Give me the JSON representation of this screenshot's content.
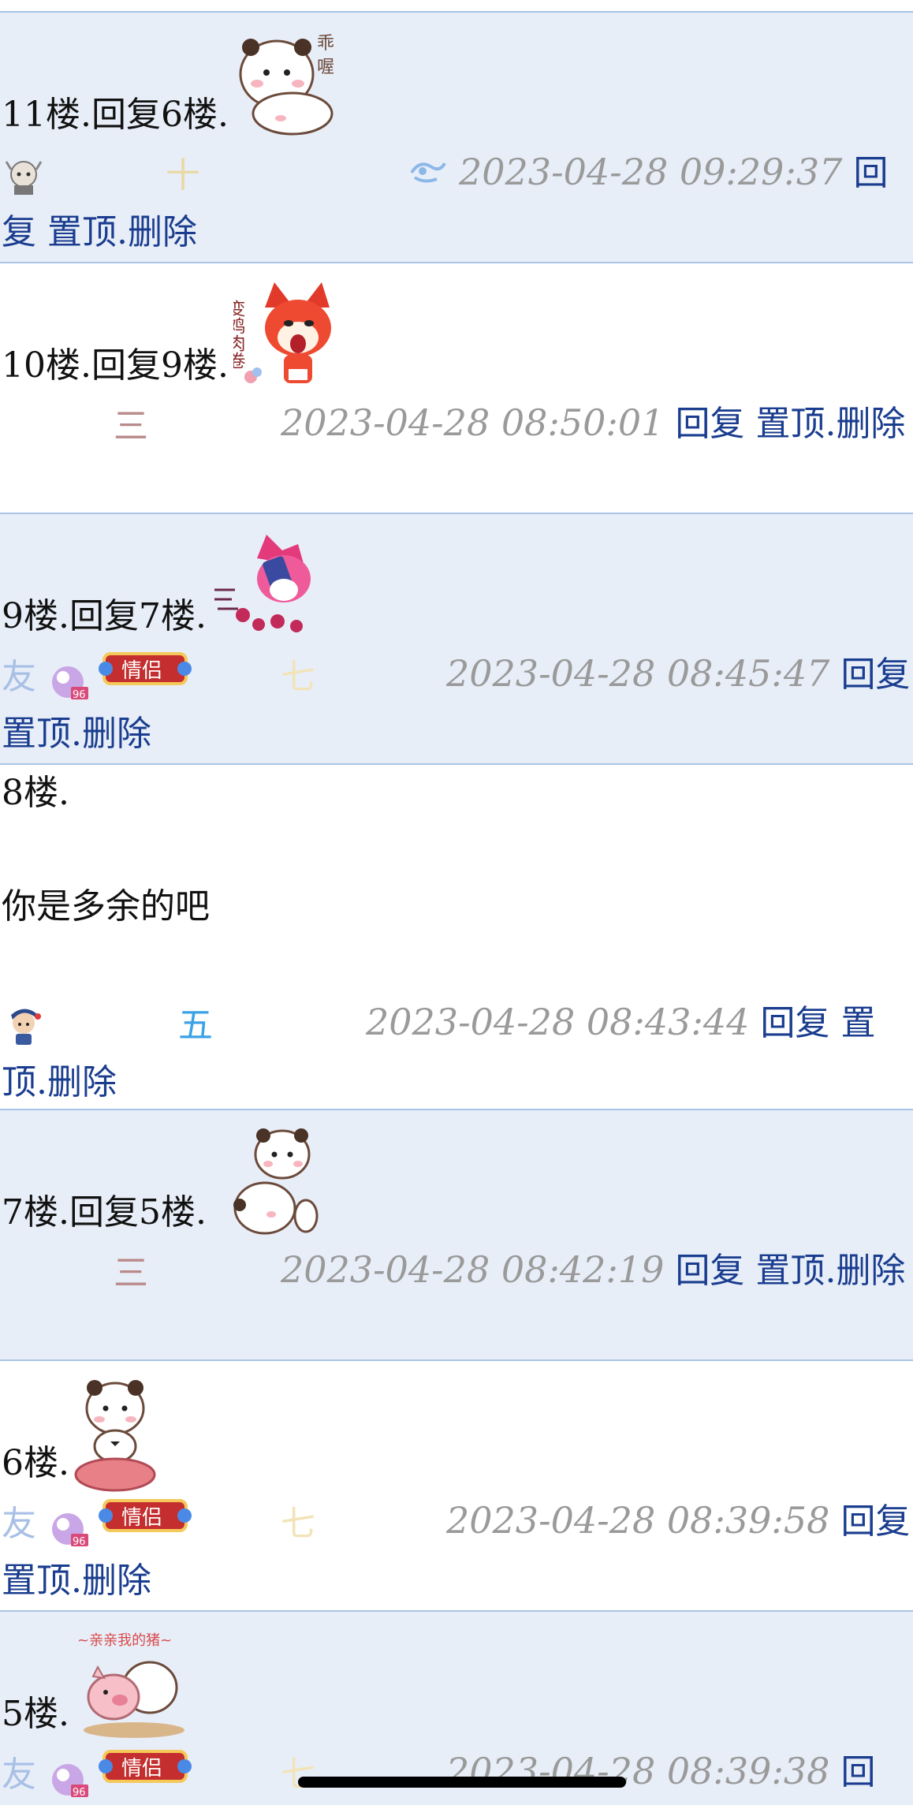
{
  "posts": [
    {
      "text": "11楼.回复6楼.",
      "rank": "十",
      "rank_color": "#e8d9a6",
      "timestamp": "2023-04-28 09:29:37",
      "reply": "回复",
      "pin": "置顶",
      "dot": ".",
      "delete": "删除",
      "sticker": "panda-hug-sticker",
      "sticker_text_1": "乖",
      "sticker_text_2": "喔"
    },
    {
      "text": "10楼.回复9楼.",
      "rank": "三",
      "rank_color": "#b98a8a",
      "timestamp": "2023-04-28 08:50:01",
      "reply": "回复",
      "pin": "置顶",
      "dot": ".",
      "delete": "删除",
      "sticker": "red-fox-sticker",
      "sticker_text": "变鸡肉卷"
    },
    {
      "text": "9楼.回复7楼.",
      "rank": "七",
      "rank_color": "#f2e3b8",
      "timestamp": "2023-04-28 08:45:47",
      "reply": "回复",
      "pin": "置顶",
      "dot": ".",
      "delete": "删除",
      "sticker": "pink-fox-sticker",
      "badge": "情侣",
      "badge_num": "96"
    },
    {
      "text": "8楼.",
      "body": "你是多余的吧",
      "rank": "五",
      "rank_color": "#3aa2e6",
      "timestamp": "2023-04-28 08:43:44",
      "reply": "回复",
      "pin": "置顶",
      "dot": ".",
      "delete": "删除"
    },
    {
      "text": "7楼.回复5楼.",
      "rank": "三",
      "rank_color": "#b98a8a",
      "timestamp": "2023-04-28 08:42:19",
      "reply": "回复",
      "pin": "置顶",
      "dot": ".",
      "delete": "删除",
      "sticker": "panda-pat-sticker"
    },
    {
      "text": "6楼.",
      "rank": "七",
      "rank_color": "#f2e3b8",
      "timestamp": "2023-04-28 08:39:58",
      "reply": "回复",
      "pin": "置顶",
      "dot": ".",
      "delete": "删除",
      "sticker": "panda-sitting-sticker",
      "badge": "情侣",
      "badge_num": "96"
    },
    {
      "text": "5楼.",
      "rank": "七",
      "rank_color": "#f2e3b8",
      "timestamp": "2023-04-28 08:39:38",
      "reply": "回",
      "sticker": "pig-kiss-sticker",
      "sticker_caption": "~亲亲我的猪~",
      "badge": "情侣",
      "badge_num": "96"
    }
  ]
}
